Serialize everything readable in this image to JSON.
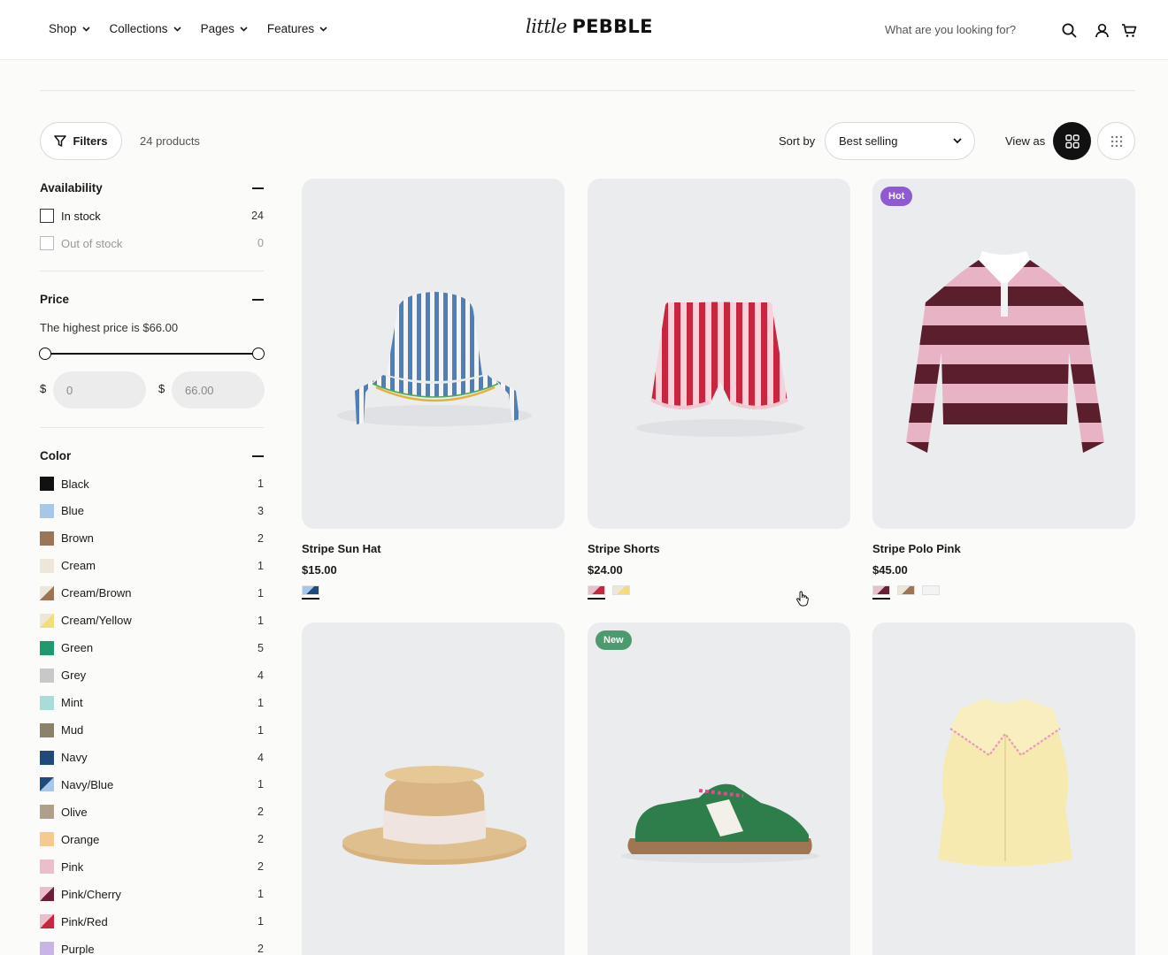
{
  "header": {
    "nav": [
      {
        "label": "Shop"
      },
      {
        "label": "Collections"
      },
      {
        "label": "Pages"
      },
      {
        "label": "Features"
      }
    ],
    "logo_script": "little",
    "logo_bold": "PEBBLE",
    "search_placeholder": "What are you looking for?",
    "icons": [
      "search-icon",
      "account-icon",
      "cart-icon"
    ]
  },
  "toolbar": {
    "filters_label": "Filters",
    "product_count": "24 products",
    "sort_label": "Sort by",
    "sort_value": "Best selling",
    "view_label": "View as"
  },
  "filters": {
    "availability": {
      "title": "Availability",
      "options": [
        {
          "label": "In stock",
          "count": "24",
          "disabled": false
        },
        {
          "label": "Out of stock",
          "count": "0",
          "disabled": true
        }
      ]
    },
    "price": {
      "title": "Price",
      "note": "The highest price is $66.00",
      "currency": "$",
      "min_placeholder": "0",
      "max_placeholder": "66.00"
    },
    "color": {
      "title": "Color",
      "options": [
        {
          "label": "Black",
          "count": "1",
          "colors": [
            "#111111"
          ]
        },
        {
          "label": "Blue",
          "count": "3",
          "colors": [
            "#a8c6ea"
          ]
        },
        {
          "label": "Brown",
          "count": "2",
          "colors": [
            "#9b7555"
          ]
        },
        {
          "label": "Cream",
          "count": "1",
          "colors": [
            "#efe6da"
          ]
        },
        {
          "label": "Cream/Brown",
          "count": "1",
          "colors": [
            "#efe6da",
            "#9b7555"
          ]
        },
        {
          "label": "Cream/Yellow",
          "count": "1",
          "colors": [
            "#efe6da",
            "#f3dc7a"
          ]
        },
        {
          "label": "Green",
          "count": "5",
          "colors": [
            "#1f9a6e"
          ]
        },
        {
          "label": "Grey",
          "count": "4",
          "colors": [
            "#c8c8c8"
          ]
        },
        {
          "label": "Mint",
          "count": "1",
          "colors": [
            "#a9dcd9"
          ]
        },
        {
          "label": "Mud",
          "count": "1",
          "colors": [
            "#8b8368"
          ]
        },
        {
          "label": "Navy",
          "count": "4",
          "colors": [
            "#1f4b7a"
          ]
        },
        {
          "label": "Navy/Blue",
          "count": "1",
          "colors": [
            "#1f4b7a",
            "#a8c6ea"
          ]
        },
        {
          "label": "Olive",
          "count": "2",
          "colors": [
            "#b1a088"
          ]
        },
        {
          "label": "Orange",
          "count": "2",
          "colors": [
            "#f6c98e"
          ]
        },
        {
          "label": "Pink",
          "count": "2",
          "colors": [
            "#eabfca"
          ]
        },
        {
          "label": "Pink/Cherry",
          "count": "1",
          "colors": [
            "#eabfca",
            "#6b1f35"
          ]
        },
        {
          "label": "Pink/Red",
          "count": "1",
          "colors": [
            "#eabfca",
            "#c8253f"
          ]
        },
        {
          "label": "Purple",
          "count": "2",
          "colors": [
            "#c8b4e6"
          ]
        }
      ]
    }
  },
  "products": [
    {
      "title": "Stripe Sun Hat",
      "price": "$15.00",
      "badge": "",
      "swatches": [
        [
          "#a8c6ea",
          "#1f4b7a"
        ]
      ]
    },
    {
      "title": "Stripe Shorts",
      "price": "$24.00",
      "badge": "",
      "swatches": [
        [
          "#eabfca",
          "#c8253f"
        ],
        [
          "#efe6da",
          "#f3dc7a"
        ]
      ]
    },
    {
      "title": "Stripe Polo Pink",
      "price": "$45.00",
      "badge": "Hot",
      "badge_color": "#8f5ad1",
      "swatches": [
        [
          "#eabfca",
          "#6b1f35"
        ],
        [
          "#efe6da",
          "#9b7555"
        ],
        [
          "#f3f3f3",
          "#f3f3f3"
        ]
      ]
    },
    {
      "title": "",
      "price": "",
      "badge": "",
      "swatches": []
    },
    {
      "title": "",
      "price": "",
      "badge": "New",
      "badge_color": "#4e9a6f",
      "swatches": []
    },
    {
      "title": "",
      "price": "",
      "badge": "",
      "swatches": []
    }
  ]
}
